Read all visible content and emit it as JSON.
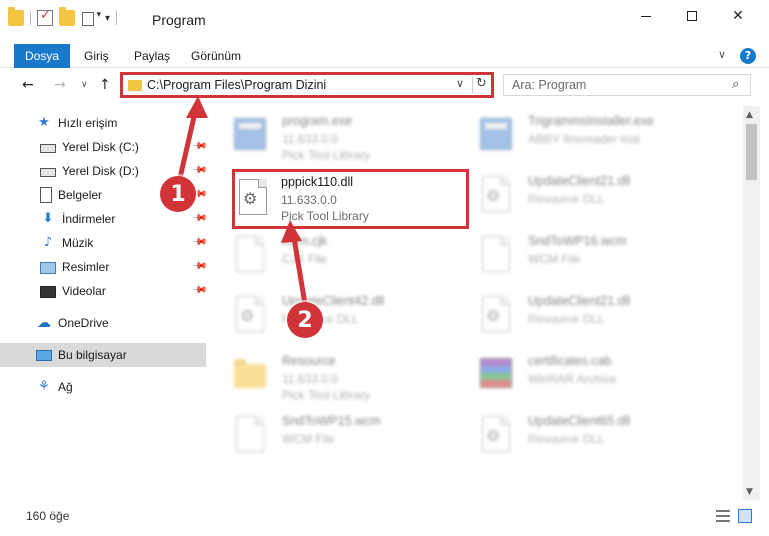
{
  "window": {
    "title": "Program",
    "minimize_glyph": "—",
    "maximize_glyph": "☐",
    "close_glyph": "✕"
  },
  "ribbon": {
    "tabs": [
      "Dosya",
      "Giriş",
      "Paylaş",
      "Görünüm"
    ],
    "expand_glyph": "∨",
    "help_glyph": "?"
  },
  "navigation": {
    "back_glyph": "←",
    "forward_glyph": "→",
    "recent_glyph": "∨",
    "up_glyph": "↑",
    "address": "C:\\Program Files\\Program Dizini",
    "address_dropdown_glyph": "∨",
    "refresh_glyph": "↻",
    "search_placeholder": "Ara: Program",
    "search_glyph": "⌕"
  },
  "sidebar": {
    "items": [
      {
        "label": "Hızlı erişim",
        "icon": "star-icon",
        "glyph": "★"
      },
      {
        "label": "Yerel Disk (C:)",
        "icon": "drive-icon",
        "glyph": ""
      },
      {
        "label": "Yerel Disk (D:)",
        "icon": "drive-icon",
        "glyph": ""
      },
      {
        "label": "Belgeler",
        "icon": "documents-icon",
        "glyph": ""
      },
      {
        "label": "İndirmeler",
        "icon": "downloads-icon",
        "glyph": "⬇"
      },
      {
        "label": "Müzik",
        "icon": "music-icon",
        "glyph": "♪"
      },
      {
        "label": "Resimler",
        "icon": "pictures-icon",
        "glyph": ""
      },
      {
        "label": "Videolar",
        "icon": "videos-icon",
        "glyph": ""
      },
      {
        "label": "OneDrive",
        "icon": "onedrive-icon",
        "glyph": "☁"
      },
      {
        "label": "Bu bilgisayar",
        "icon": "this-pc-icon",
        "glyph": ""
      },
      {
        "label": "Ağ",
        "icon": "network-icon",
        "glyph": "⚘"
      }
    ],
    "pin_glyph": "📌"
  },
  "files": [
    {
      "name": "program.exe",
      "line1": "11.633.0.0",
      "line2": "Pick Tool Library"
    },
    {
      "name": "TrigrammsInstaller.exe",
      "line1": "ABBY finereader trial",
      "line2": ""
    },
    {
      "name": "pppick110.dll",
      "line1": "11.633.0.0",
      "line2": "Pick Tool Library"
    },
    {
      "name": "UpdateClient21.dll",
      "line1": "Resource DLL",
      "line2": ""
    },
    {
      "name": "Korn.cjk",
      "line1": "CJK File",
      "line2": ""
    },
    {
      "name": "SndToWP16.wcm",
      "line1": "WCM File",
      "line2": ""
    },
    {
      "name": "UpdateClient42.dll",
      "line1": "Resource DLL",
      "line2": ""
    },
    {
      "name": "UpdateClient21.dll",
      "line1": "Resource DLL",
      "line2": ""
    },
    {
      "name": "Resource",
      "line1": "11.633.0.0",
      "line2": "Pick Tool Library"
    },
    {
      "name": "certificates.cab",
      "line1": "WinRAR Archive",
      "line2": ""
    },
    {
      "name": "SndToWP15.wcm",
      "line1": "WCM File",
      "line2": ""
    },
    {
      "name": "UpdateClient65.dll",
      "line1": "Resource DLL",
      "line2": ""
    }
  ],
  "gear_glyph": "⚙",
  "status": {
    "count": "160 öğe"
  },
  "scrollbar": {
    "up_glyph": "▲",
    "down_glyph": "▼"
  },
  "annotations": {
    "step1": "1",
    "step2": "2",
    "color": "#d13438"
  },
  "colors": {
    "accent": "#1979ca",
    "highlight": "#d13438",
    "folder": "#f4c542"
  }
}
